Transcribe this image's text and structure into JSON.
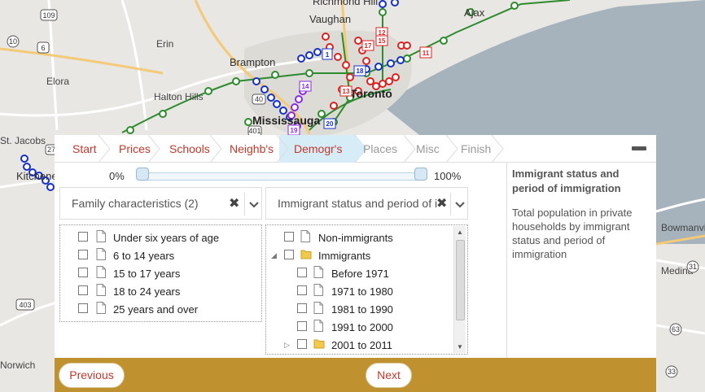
{
  "map": {
    "labels": {
      "richmond_hill": "Richmond Hill",
      "vaughan": "Vaughan",
      "ajax": "Ajax",
      "erin": "Erin",
      "brampton": "Brampton",
      "elora": "Elora",
      "halton_hills": "Halton Hills",
      "mississauga": "Mississauga",
      "toronto": "Toronto",
      "st_jacobs": "St. Jacobs",
      "kitchener": "Kitchener",
      "bowmanville": "Bowmanville",
      "medina": "Medina",
      "norwich": "Norwich"
    },
    "highways": {
      "h109": "109",
      "h6": "6",
      "h10": "10",
      "h403": "403",
      "h401": "401",
      "h40": "40",
      "h27": "27",
      "h31": "31",
      "h63": "63",
      "h33": "33"
    },
    "markers": {
      "m1": "1",
      "m11": "11",
      "m12": "12",
      "m13": "13",
      "m15": "15",
      "m17": "17",
      "m18": "18",
      "m19": "19",
      "m20": "20",
      "m14": "14"
    }
  },
  "wizard": {
    "steps": [
      {
        "label": "Start",
        "state": "done"
      },
      {
        "label": "Prices",
        "state": "done"
      },
      {
        "label": "Schools",
        "state": "done"
      },
      {
        "label": "Neighb's",
        "state": "done"
      },
      {
        "label": "Demogr's",
        "state": "active"
      },
      {
        "label": "Places",
        "state": "todo"
      },
      {
        "label": "Misc",
        "state": "todo"
      },
      {
        "label": "Finish",
        "state": "todo"
      }
    ],
    "slider": {
      "min_label": "0%",
      "max_label": "100%",
      "low_value": 0,
      "high_value": 100
    },
    "left_combo": {
      "value": "Family characteristics (2)",
      "clear": "✖"
    },
    "right_combo": {
      "value": "Immigrant status and period of im",
      "clear": "✖"
    },
    "left_list": [
      {
        "label": "Under six years of age"
      },
      {
        "label": "6 to 14 years"
      },
      {
        "label": "15 to 17 years"
      },
      {
        "label": "18 to 24 years"
      },
      {
        "label": "25 years and over"
      }
    ],
    "right_list": [
      {
        "label": "Non-immigrants",
        "type": "doc",
        "level": 0
      },
      {
        "label": "Immigrants",
        "type": "folder",
        "level": 0,
        "expanded": true
      },
      {
        "label": "Before 1971",
        "type": "doc",
        "level": 1
      },
      {
        "label": "1971 to 1980",
        "type": "doc",
        "level": 1
      },
      {
        "label": "1981 to 1990",
        "type": "doc",
        "level": 1
      },
      {
        "label": "1991 to 2000",
        "type": "doc",
        "level": 1
      },
      {
        "label": "2001 to 2011",
        "type": "folder",
        "level": 1,
        "expanded": false
      }
    ],
    "info": {
      "title": "Immigrant status and period of immigration",
      "body": "Total population in private households by immigrant status and period of immigration"
    },
    "footer": {
      "previous_label": "Previous",
      "next_label": "Next"
    },
    "colors": {
      "accent": "#c0392b",
      "footer": "#c0912f",
      "active_step": "#d6ecf6"
    }
  }
}
